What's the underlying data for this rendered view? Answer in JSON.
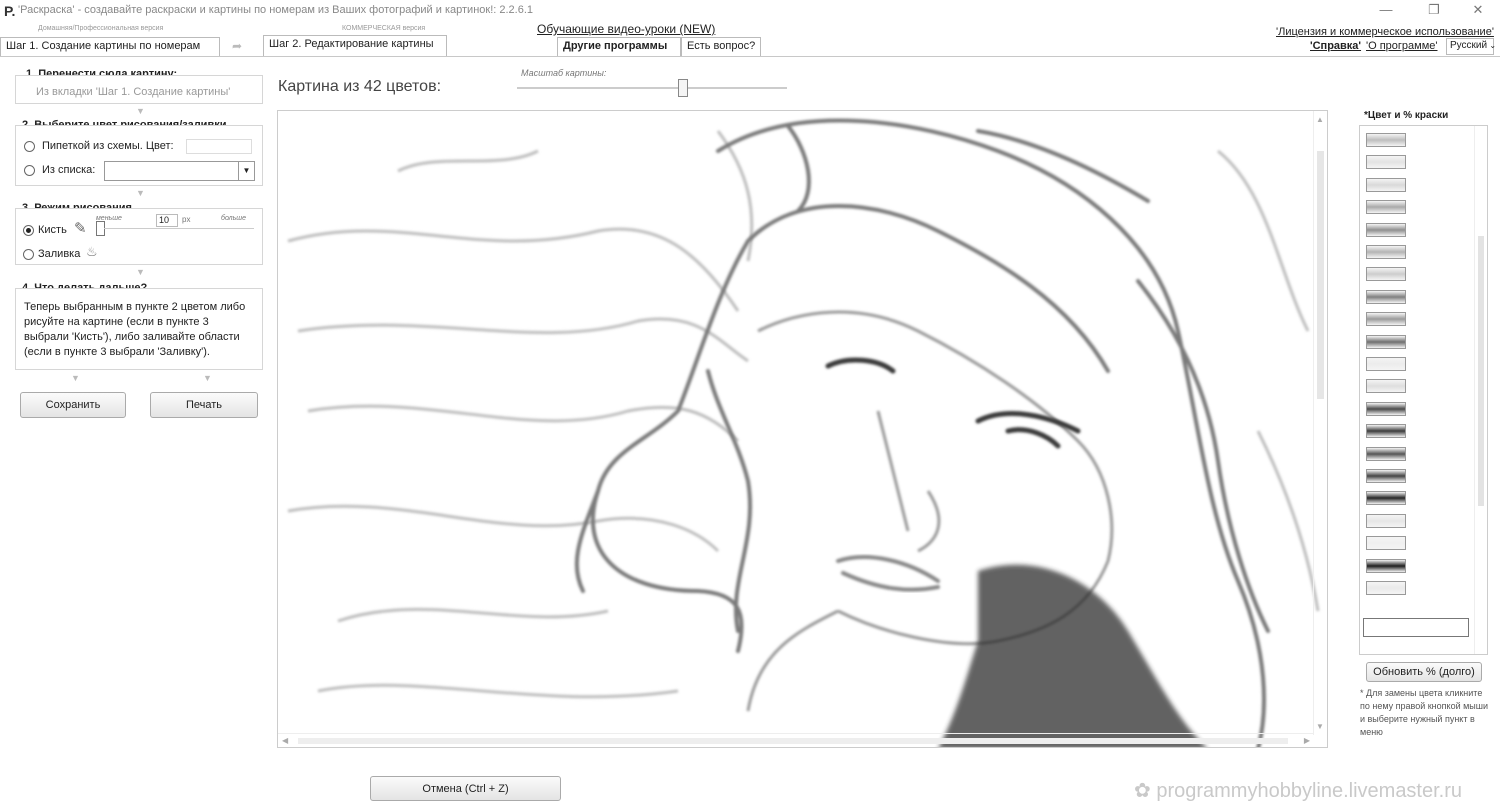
{
  "window": {
    "title": "'Раскраска' - создавайте раскраски и картины по номерам из Ваших фотографий и картинок!: 2.2.6.1",
    "app_icon": "P."
  },
  "top": {
    "video_link": "Обучающие видео-уроки (NEW)",
    "license_link": "'Лицензия и коммерческое использование'",
    "help_link": "'Справка'",
    "about_link": "'О программе'",
    "language": "Русский"
  },
  "tabs": [
    {
      "sub": "Домашняя/Профессиональная версия",
      "label": "Шаг 1. Создание картины по номерам"
    },
    {
      "sub": "КОММЕРЧЕСКАЯ версия",
      "label": "Шаг 2. Редактирование картины"
    }
  ],
  "menu": {
    "other_programs": "Другие программы",
    "question": "Есть вопрос?"
  },
  "left": {
    "step1": {
      "title": "1. Перенести сюда картину:",
      "hint": "Из вкладки 'Шаг 1. Создание картины'"
    },
    "step2": {
      "title": "2. Выберите цвет рисования/заливки",
      "pipette": "Пипеткой из схемы. Цвет:",
      "from_list": "Из списка:"
    },
    "step3": {
      "title": "3. Режим рисования",
      "brush": "Кисть",
      "fill": "Заливка",
      "less": "меньше",
      "more": "больше",
      "size": "10",
      "unit": "px"
    },
    "step4": {
      "title": "4. Что делать дальше?",
      "text": "Теперь выбранным в пункте 2 цветом либо рисуйте на картине (если в пункте 3 выбрали 'Кисть'), либо заливайте области (если в пункте 3 выбрали 'Заливку')."
    },
    "save_label": "Сохранить",
    "print_label": "Печать"
  },
  "main": {
    "colors_title": "Картина из 42 цветов:",
    "scale_label": "Масштаб картины:",
    "scale_value": 0.62,
    "undo_label": "Отмена (Ctrl + Z)"
  },
  "palette": {
    "title": "*Цвет и % краски",
    "update_label": "Обновить % (долго)",
    "note": "* Для замены цвета кликните по нему правой кнопкой мыши и выберите нужный пункт в меню",
    "swatches": [
      "#bdbdbd",
      "#e3e3e3",
      "#d9d9d9",
      "#a9a9a9",
      "#8f8f8f",
      "#b4b4b4",
      "#cdcdcd",
      "#7f7f7f",
      "#9a9a9a",
      "#6f6f6f",
      "#ececec",
      "#dedede",
      "#4a4a4a",
      "#3c3c3c",
      "#555555",
      "#444444",
      "#262626",
      "#e6e6e6",
      "#f0f0f0",
      "#1e1e1e",
      "#eaeaea"
    ]
  },
  "watermark": "programmyhobbyline.livemaster.ru"
}
